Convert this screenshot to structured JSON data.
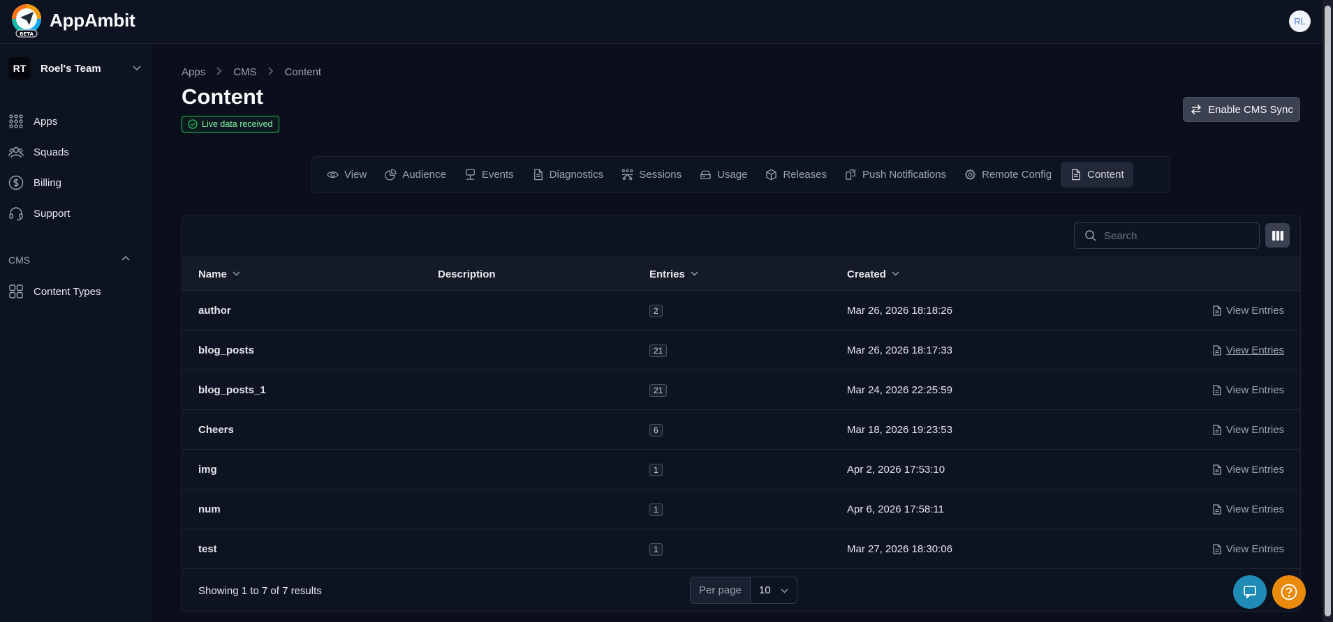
{
  "app": {
    "name": "AppAmbit",
    "logo_badge": "BETA",
    "user_initials": "RL"
  },
  "sidebar": {
    "team": {
      "initials": "RT",
      "name": "Roel's Team"
    },
    "items": [
      {
        "label": "Apps",
        "icon": "grid-dots-icon"
      },
      {
        "label": "Squads",
        "icon": "users-icon"
      },
      {
        "label": "Billing",
        "icon": "dollar-circle-icon"
      },
      {
        "label": "Support",
        "icon": "headset-icon"
      }
    ],
    "cms_section": {
      "label": "CMS",
      "items": [
        {
          "label": "Content Types",
          "icon": "squares-icon"
        }
      ]
    }
  },
  "breadcrumb": [
    "Apps",
    "CMS",
    "Content"
  ],
  "page": {
    "title": "Content",
    "live_badge": "Live data received",
    "sync_button": "Enable CMS Sync"
  },
  "tabs": [
    {
      "label": "View",
      "icon": "eye-icon"
    },
    {
      "label": "Audience",
      "icon": "pie-icon"
    },
    {
      "label": "Events",
      "icon": "events-icon"
    },
    {
      "label": "Diagnostics",
      "icon": "document-icon"
    },
    {
      "label": "Sessions",
      "icon": "sessions-icon"
    },
    {
      "label": "Usage",
      "icon": "usage-icon"
    },
    {
      "label": "Releases",
      "icon": "box-icon"
    },
    {
      "label": "Push Notifications",
      "icon": "push-icon"
    },
    {
      "label": "Remote Config",
      "icon": "gear-icon"
    },
    {
      "label": "Content",
      "icon": "document-icon",
      "active": true
    }
  ],
  "table": {
    "search_placeholder": "Search",
    "columns": {
      "name": "Name",
      "description": "Description",
      "entries": "Entries",
      "created": "Created"
    },
    "action_label": "View Entries",
    "rows": [
      {
        "name": "author",
        "description": "",
        "entries": "2",
        "created": "Mar 26, 2026 18:18:26"
      },
      {
        "name": "blog_posts",
        "description": "",
        "entries": "21",
        "created": "Mar 26, 2026 18:17:33"
      },
      {
        "name": "blog_posts_1",
        "description": "",
        "entries": "21",
        "created": "Mar 24, 2026 22:25:59"
      },
      {
        "name": "Cheers",
        "description": "",
        "entries": "6",
        "created": "Mar 18, 2026 19:23:53"
      },
      {
        "name": "img",
        "description": "",
        "entries": "1",
        "created": "Apr 2, 2026 17:53:10"
      },
      {
        "name": "num",
        "description": "",
        "entries": "1",
        "created": "Apr 6, 2026 17:58:11"
      },
      {
        "name": "test",
        "description": "",
        "entries": "1",
        "created": "Mar 27, 2026 18:30:06"
      }
    ],
    "footer": {
      "showing": "Showing 1 to 7 of 7 results",
      "per_page_label": "Per page",
      "per_page_value": "10"
    }
  }
}
